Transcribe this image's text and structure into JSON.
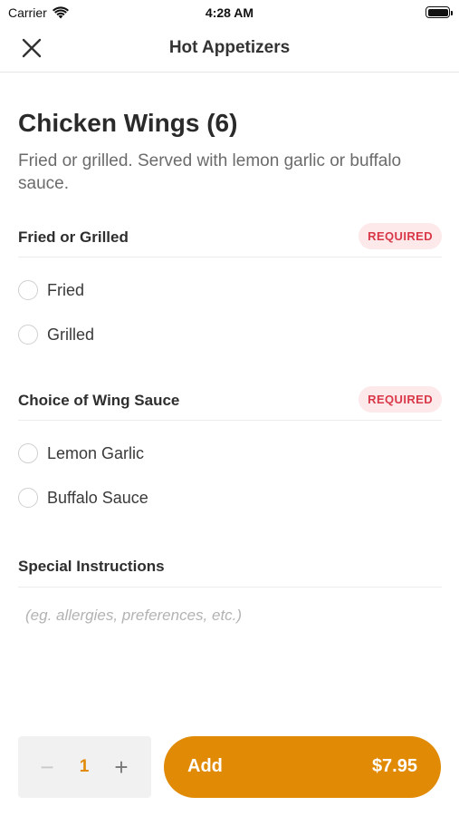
{
  "status_bar": {
    "carrier": "Carrier",
    "time": "4:28 AM"
  },
  "nav": {
    "title": "Hot Appetizers",
    "close_icon": "close-icon"
  },
  "item": {
    "title": "Chicken Wings (6)",
    "description": "Fried or grilled. Served with lemon garlic or buffalo sauce."
  },
  "sections": [
    {
      "title": "Fried or Grilled",
      "badge": "REQUIRED",
      "options": [
        "Fried",
        "Grilled"
      ]
    },
    {
      "title": "Choice of Wing Sauce",
      "badge": "REQUIRED",
      "options": [
        "Lemon Garlic",
        "Buffalo Sauce"
      ]
    }
  ],
  "special_instructions": {
    "title": "Special Instructions",
    "placeholder": "(eg. allergies, preferences, etc.)",
    "value": ""
  },
  "quantity": {
    "value": "1",
    "minus_symbol": "−",
    "plus_symbol": "+"
  },
  "add_button": {
    "label": "Add",
    "price": "$7.95"
  },
  "colors": {
    "accent": "#e08a06",
    "required_badge_bg": "#fde8ea",
    "required_badge_text": "#d93848"
  }
}
